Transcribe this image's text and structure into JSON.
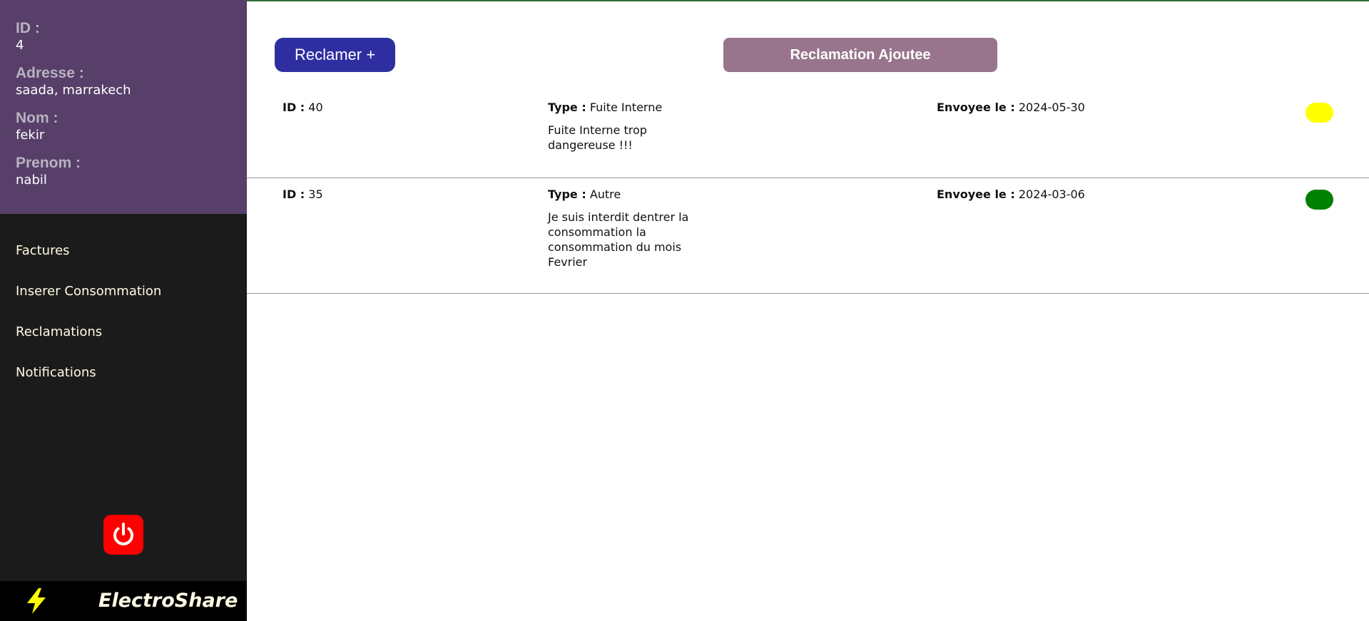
{
  "profile": {
    "id_label": "ID :",
    "id_value": "4",
    "address_label": "Adresse :",
    "address_value": "saada, marrakech",
    "nom_label": "Nom :",
    "nom_value": "fekir",
    "prenom_label": "Prenom :",
    "prenom_value": "nabil"
  },
  "nav": {
    "items": [
      {
        "label": "Factures"
      },
      {
        "label": "Inserer Consommation"
      },
      {
        "label": "Reclamations"
      },
      {
        "label": "Notifications"
      }
    ]
  },
  "brand": {
    "name": "ElectroShare",
    "icon": "lightning-bolt-icon"
  },
  "actions": {
    "reclamer_label": "Reclamer +",
    "power_icon": "power-icon"
  },
  "alert": {
    "message": "Reclamation Ajoutee"
  },
  "field_labels": {
    "id": "ID :",
    "type": "Type :",
    "date": "Envoyee le :"
  },
  "reclamations": [
    {
      "id": "40",
      "type": "Fuite Interne",
      "description": "Fuite Interne trop dangereuse !!!",
      "date": "2024-05-30",
      "status_color": "#ffff00"
    },
    {
      "id": "35",
      "type": "Autre",
      "description": "Je suis interdit dentrer la consommation la consommation du mois Fevrier",
      "date": "2024-03-06",
      "status_color": "#008000"
    }
  ],
  "colors": {
    "profile_bg": "#573f69",
    "sidebar_bg": "#1b1b1b",
    "primary_button": "#2e2ea0",
    "banner_bg": "#98758c",
    "power": "#ff0000"
  }
}
